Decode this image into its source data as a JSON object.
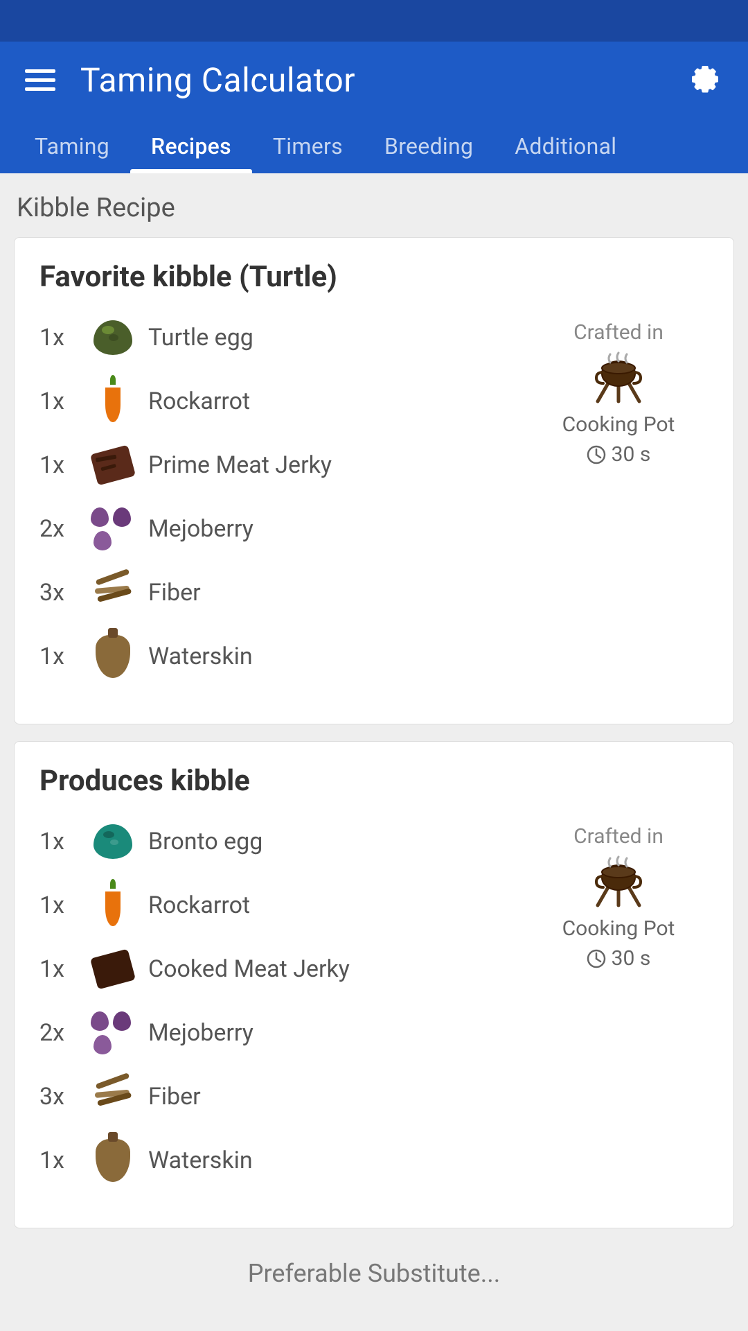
{
  "app": {
    "title": "Taming Calculator"
  },
  "tabs": [
    {
      "label": "Taming",
      "active": false
    },
    {
      "label": "Recipes",
      "active": true
    },
    {
      "label": "Timers",
      "active": false
    },
    {
      "label": "Breeding",
      "active": false
    },
    {
      "label": "Additional",
      "active": false
    }
  ],
  "section": {
    "title": "Kibble Recipe"
  },
  "recipes": [
    {
      "title": "Favorite kibble (Turtle)",
      "ingredients": [
        {
          "qty": "1x",
          "icon": "turtle-egg",
          "name": "Turtle egg"
        },
        {
          "qty": "1x",
          "icon": "carrot",
          "name": "Rockarrot"
        },
        {
          "qty": "1x",
          "icon": "prime-meat-jerky",
          "name": "Prime Meat Jerky"
        },
        {
          "qty": "2x",
          "icon": "mejoberry",
          "name": "Mejoberry"
        },
        {
          "qty": "3x",
          "icon": "fiber",
          "name": "Fiber"
        },
        {
          "qty": "1x",
          "icon": "waterskin",
          "name": "Waterskin"
        }
      ],
      "crafted_in_label": "Crafted in",
      "crafted_in_name": "Cooking Pot",
      "crafted_in_time": "30 s"
    },
    {
      "title": "Produces kibble",
      "ingredients": [
        {
          "qty": "1x",
          "icon": "bronto-egg",
          "name": "Bronto egg"
        },
        {
          "qty": "1x",
          "icon": "carrot",
          "name": "Rockarrot"
        },
        {
          "qty": "1x",
          "icon": "cooked-meat-jerky",
          "name": "Cooked Meat Jerky"
        },
        {
          "qty": "2x",
          "icon": "mejoberry",
          "name": "Mejoberry"
        },
        {
          "qty": "3x",
          "icon": "fiber",
          "name": "Fiber"
        },
        {
          "qty": "1x",
          "icon": "waterskin",
          "name": "Waterskin"
        }
      ],
      "crafted_in_label": "Crafted in",
      "crafted_in_name": "Cooking Pot",
      "crafted_in_time": "30 s"
    }
  ],
  "bottom_hint": "Preferable Substitute..."
}
